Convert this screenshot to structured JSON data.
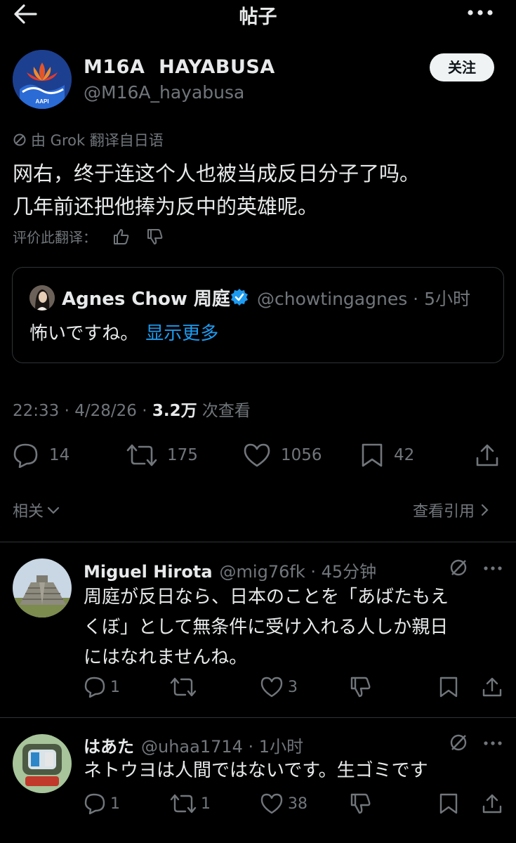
{
  "header": {
    "title": "帖子",
    "back_icon": "arrow-left-icon",
    "more_icon": "more-icon"
  },
  "post": {
    "author_name": "M16A  HAYABUSA",
    "author_handle": "@M16A_hayabusa",
    "avatar_text": "AAPI",
    "follow_label": "关注",
    "translation_note": "由 Grok 翻译自日语",
    "text_line1": "网右，终于连这个人也被当成反日分子了吗。",
    "text_line2": "几年前还把他捧为反中的英雄呢。",
    "rate_label": "评价此翻译：",
    "quote": {
      "name": "Agnes Chow 周庭",
      "handle_time": "@chowtingagnes · 5小时",
      "text": "怖いですね。",
      "show_more": "显示更多"
    },
    "timestamp": "22:33 · 4/28/26 · ",
    "views_count": "3.2万",
    "views_label": " 次查看",
    "actions": {
      "replies": "14",
      "reposts": "175",
      "likes": "1056",
      "bookmarks": "42"
    },
    "related_label": "相关",
    "view_quotes_label": "查看引用"
  },
  "replies": [
    {
      "name": "Miguel Hirota",
      "handle_time": "@mig76fk · 45分钟",
      "lines": [
        "周庭が反日なら、日本のことを「あばたもえ",
        "くぼ」として無条件に受け入れる人しか親日",
        "にはなれませんね。"
      ],
      "replies": "1",
      "reposts": "",
      "likes": "3"
    },
    {
      "name": "はあた",
      "handle_time": "@uhaa1714 · 1小时",
      "lines": [
        "ネトウヨは人間ではないです。生ゴミです"
      ],
      "replies": "1",
      "reposts": "1",
      "likes": "38"
    }
  ],
  "colors": {
    "background": "#000000",
    "text": "#e7e9ea",
    "muted": "#71767b",
    "link": "#1d9bf0",
    "divider": "#2f3336"
  }
}
